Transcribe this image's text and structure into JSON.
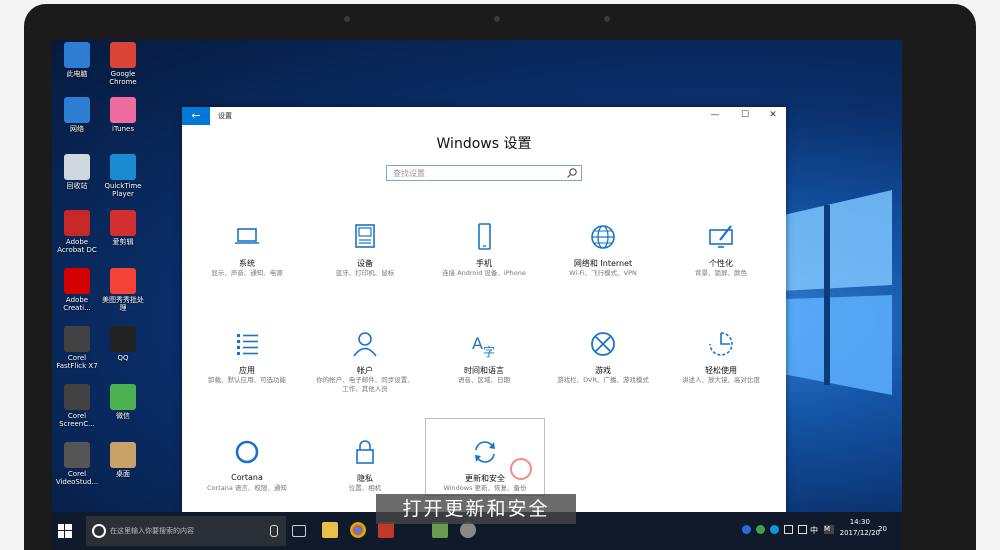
{
  "desktop_icons": [
    {
      "label": "此电脑"
    },
    {
      "label": "Google Chrome"
    },
    {
      "label": "网络"
    },
    {
      "label": "iTunes"
    },
    {
      "label": "回收站"
    },
    {
      "label": "QuickTime Player"
    },
    {
      "label": "Adobe Acrobat DC"
    },
    {
      "label": "爱剪辑"
    },
    {
      "label": "Adobe Creati..."
    },
    {
      "label": "美图秀秀批处理"
    },
    {
      "label": "Corel FastFlick X7"
    },
    {
      "label": "QQ"
    },
    {
      "label": "Corel ScreenC..."
    },
    {
      "label": "微信"
    },
    {
      "label": "Corel VideoStud..."
    },
    {
      "label": "桌面"
    }
  ],
  "window": {
    "back_icon": "←",
    "title": "设置",
    "heading": "Windows 设置",
    "search_placeholder": "查找设置",
    "controls": {
      "minimize": "—",
      "maximize": "☐",
      "close": "✕"
    }
  },
  "tiles": [
    {
      "name": "系统",
      "desc": "显示、声音、通知、电源",
      "icon": "laptop-icon"
    },
    {
      "name": "设备",
      "desc": "蓝牙、打印机、鼠标",
      "icon": "keyboard-icon"
    },
    {
      "name": "手机",
      "desc": "连接 Android 设备、iPhone",
      "icon": "phone-icon"
    },
    {
      "name": "网络和 Internet",
      "desc": "Wi-Fi、飞行模式、VPN",
      "icon": "globe-icon"
    },
    {
      "name": "个性化",
      "desc": "背景、锁屏、颜色",
      "icon": "pen-monitor-icon"
    },
    {
      "name": "应用",
      "desc": "卸载、默认应用、可选功能",
      "icon": "list-icon"
    },
    {
      "name": "帐户",
      "desc": "你的帐户、电子邮件、同步设置、工作、其他人员",
      "icon": "person-icon"
    },
    {
      "name": "时间和语言",
      "desc": "语音、区域、日期",
      "icon": "language-icon"
    },
    {
      "name": "游戏",
      "desc": "游戏栏、DVR、广播、游戏模式",
      "icon": "xbox-icon"
    },
    {
      "name": "轻松使用",
      "desc": "讲述人、放大镜、高对比度",
      "icon": "ease-of-access-icon"
    },
    {
      "name": "Cortana",
      "desc": "Cortana 语言、权限、通知",
      "icon": "cortana-icon"
    },
    {
      "name": "隐私",
      "desc": "位置、相机",
      "icon": "lock-icon"
    },
    {
      "name": "更新和安全",
      "desc": "Windows 更新、恢复、备份",
      "icon": "sync-icon"
    }
  ],
  "taskbar": {
    "search_placeholder": "在这里输入你要搜索的内容",
    "time": "14:30",
    "date": "2017/12/20",
    "ime_label": "中",
    "tray_m": "M",
    "notification_badge": "20"
  },
  "caption": "打开更新和安全",
  "colors": {
    "accent": "#0078d7",
    "icon_blue": "#1a73c8"
  }
}
